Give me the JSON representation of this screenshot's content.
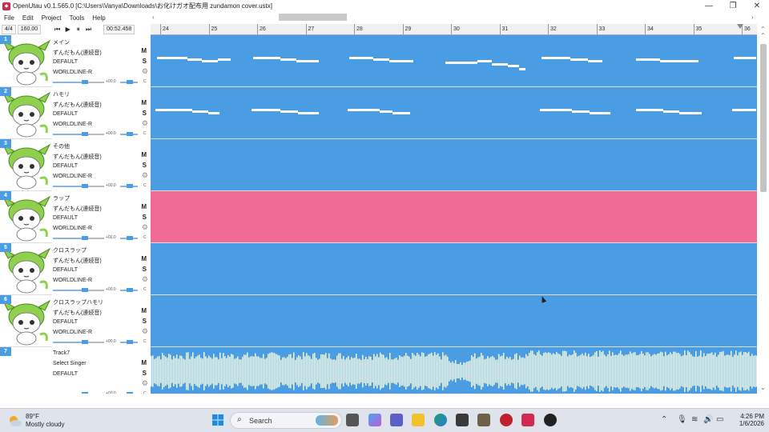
{
  "window": {
    "title": "OpenUtau v0.1.565.0 [C:\\Users\\Vanya\\Downloads\\お化けガオ配布用 zundamon cover.ustx]"
  },
  "menu": [
    "File",
    "Edit",
    "Project",
    "Tools",
    "Help"
  ],
  "toolbar": {
    "time_signature": "4/4",
    "bpm": "160.00",
    "position": "00:52.458"
  },
  "ruler": {
    "bars": [
      "24",
      "25",
      "26",
      "27",
      "28",
      "29",
      "30",
      "31",
      "32",
      "33",
      "34",
      "35",
      "36"
    ]
  },
  "tracks": [
    {
      "number": "1",
      "name": "メイン",
      "singer": "ずんだもん(連続音)",
      "phonemizer": "DEFAULT",
      "renderer": "WORLDLINE-R",
      "mute": "M",
      "solo": "S",
      "volume": "+00.0",
      "pan": "C",
      "part_color": "#4a9de3"
    },
    {
      "number": "2",
      "name": "ハモリ",
      "singer": "ずんだもん(連続音)",
      "phonemizer": "DEFAULT",
      "renderer": "WORLDLINE-R",
      "mute": "M",
      "solo": "S",
      "volume": "+00.0",
      "pan": "C",
      "part_color": "#4a9de3"
    },
    {
      "number": "3",
      "name": "その他",
      "singer": "ずんだもん(連続音)",
      "phonemizer": "DEFAULT",
      "renderer": "WORLDLINE-R",
      "mute": "M",
      "solo": "S",
      "volume": "+00.0",
      "pan": "C",
      "part_color": "#4a9de3"
    },
    {
      "number": "4",
      "name": "ラップ",
      "singer": "ずんだもん(連続音)",
      "phonemizer": "DEFAULT",
      "renderer": "WORLDLINE-R",
      "mute": "M",
      "solo": "S",
      "volume": "+00.0",
      "pan": "C",
      "part_color": "#f26b95"
    },
    {
      "number": "5",
      "name": "クロスラップ",
      "singer": "ずんだもん(連続音)",
      "phonemizer": "DEFAULT",
      "renderer": "WORLDLINE-R",
      "mute": "M",
      "solo": "S",
      "volume": "+00.0",
      "pan": "C",
      "part_color": "#4a9de3"
    },
    {
      "number": "6",
      "name": "クロスラップハモリ",
      "singer": "ずんだもん(連続音)",
      "phonemizer": "DEFAULT",
      "renderer": "WORLDLINE-R",
      "mute": "M",
      "solo": "S",
      "volume": "+00.0",
      "pan": "C",
      "part_color": "#4a9de3"
    },
    {
      "number": "7",
      "name": "Track7",
      "singer": "Select Singer",
      "phonemizer": "DEFAULT",
      "renderer": "",
      "mute": "M",
      "solo": "S",
      "volume": "+00.0",
      "pan": "C",
      "part_color": "#4a9de3"
    }
  ],
  "taskbar": {
    "weather_temp": "89°F",
    "weather_desc": "Mostly cloudy",
    "search_label": "Search",
    "time": "4:26 PM",
    "date": "1/6/2026"
  },
  "colors": {
    "accent": "#4a9de3",
    "rap_part": "#f26b95",
    "avatar_green": "#8fd14f"
  }
}
